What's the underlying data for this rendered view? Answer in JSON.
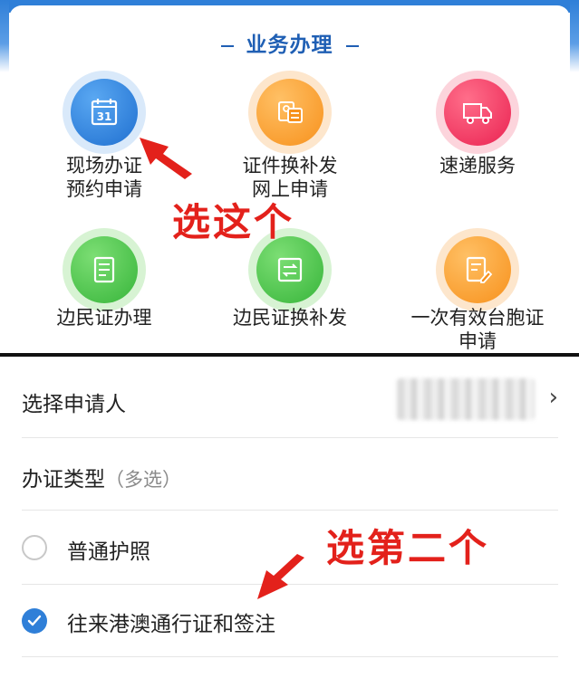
{
  "services": {
    "title": "业务办理",
    "items": [
      {
        "line1": "现场办证",
        "line2": "预约申请",
        "icon": "calendar-icon"
      },
      {
        "line1": "证件换补发",
        "line2": "网上申请",
        "icon": "id-swap-icon"
      },
      {
        "line1": "速递服务",
        "line2": "",
        "icon": "truck-icon"
      },
      {
        "line1": "边民证办理",
        "line2": "",
        "icon": "document-icon"
      },
      {
        "line1": "边民证换补发",
        "line2": "",
        "icon": "card-swap-icon"
      },
      {
        "line1": "一次有效台胞证",
        "line2": "申请",
        "icon": "edit-document-icon"
      }
    ]
  },
  "annotations": {
    "first": "选这个",
    "second": "选第二个"
  },
  "form": {
    "applicant_label": "选择申请人",
    "chevron": "›",
    "type_label": "办证类型",
    "type_hint": "（多选）",
    "options": [
      {
        "label": "普通护照",
        "checked": false
      },
      {
        "label": "往来港澳通行证和签注",
        "checked": true
      }
    ]
  },
  "colors": {
    "brand_blue": "#2f7fd8",
    "title_blue": "#1f5fb4",
    "annotation_red": "#e3211b"
  }
}
